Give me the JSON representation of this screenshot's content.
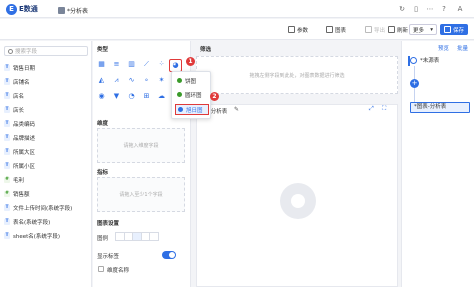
{
  "app": {
    "logo_mark": "E",
    "logo_text": "E数通",
    "tab_title": "*分析表"
  },
  "topbar_icons": [
    "back-icon",
    "pin-icon",
    "ellipsis-icon",
    "help-icon",
    "user-icon"
  ],
  "topbar_user_initial": "A",
  "toolbar": {
    "params": "参数",
    "chart": "图表",
    "export": "导出",
    "refresh": "刷新",
    "more": "更多",
    "save": "保存"
  },
  "left": {
    "search_placeholder": "搜索字段",
    "fields": [
      {
        "type": "T",
        "label": "销售日期"
      },
      {
        "type": "T",
        "label": "店铺名"
      },
      {
        "type": "T",
        "label": "店名"
      },
      {
        "type": "T",
        "label": "店长"
      },
      {
        "type": "T",
        "label": "品类编码"
      },
      {
        "type": "T",
        "label": "品牌描述"
      },
      {
        "type": "T",
        "label": "所属大区"
      },
      {
        "type": "T",
        "label": "所属小区"
      },
      {
        "type": "#",
        "label": "毛利"
      },
      {
        "type": "#",
        "label": "销售额"
      },
      {
        "type": "T",
        "label": "文件上传时间(系统字段)"
      },
      {
        "type": "T",
        "label": "表名(系统字段)"
      },
      {
        "type": "T",
        "label": "sheet名(系统字段)"
      }
    ]
  },
  "mid": {
    "type_title": "类型",
    "dimension_title": "维度",
    "dimension_placeholder": "请拖入维度字段",
    "indicator_title": "指标",
    "indicator_placeholder": "请拖入至少1个字段",
    "settings_title": "图表设置",
    "legend_label": "图例",
    "show_label": "显示标签",
    "dim_name_label": "维度名称"
  },
  "dropdown": {
    "items": [
      "饼图",
      "圆环图",
      "旭日图"
    ]
  },
  "badges": [
    "1",
    "2"
  ],
  "canvas": {
    "filter_title": "筛选",
    "filter_placeholder": "拖拽左侧字段到此处，对图表数据进行筛选",
    "chart_name": "*分析表"
  },
  "right": {
    "preview": "预览",
    "batch": "批量",
    "node1": "*未源表",
    "node2": "*图表-分析表"
  },
  "colors": {
    "accent": "#2f6fe4",
    "highlight": "#e03a3a"
  }
}
